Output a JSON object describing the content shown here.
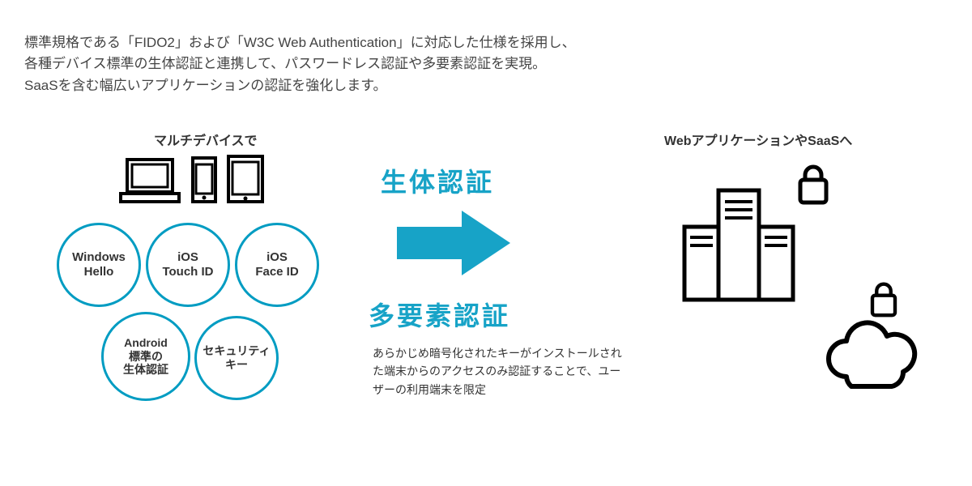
{
  "intro": {
    "line1": "標準規格である「FIDO2」および「W3C Web Authentication」に対応した仕様を採用し、",
    "line2": "各種デバイス標準の生体認証と連携して、パスワードレス認証や多要素認証を実現。",
    "line3": "SaaSを含む幅広いアプリケーションの認証を強化します。"
  },
  "left_heading": "マルチデバイスで",
  "right_heading": "WebアプリケーションやSaaSへ",
  "circles": {
    "c1": "Windows\nHello",
    "c2": "iOS\nTouch ID",
    "c3": "iOS\nFace ID",
    "c4": "Android\n標準の\n生体認証",
    "c5": "セキュリティ\nキー"
  },
  "center": {
    "biometric": "生体認証",
    "mfa": "多要素認証"
  },
  "note": "あらかじめ暗号化されたキーがインストールされた端末からのアクセスのみ認証することで、ユーザーの利用端末を限定",
  "colors": {
    "accent": "#17a3c7",
    "circle_border": "#009cc2"
  }
}
